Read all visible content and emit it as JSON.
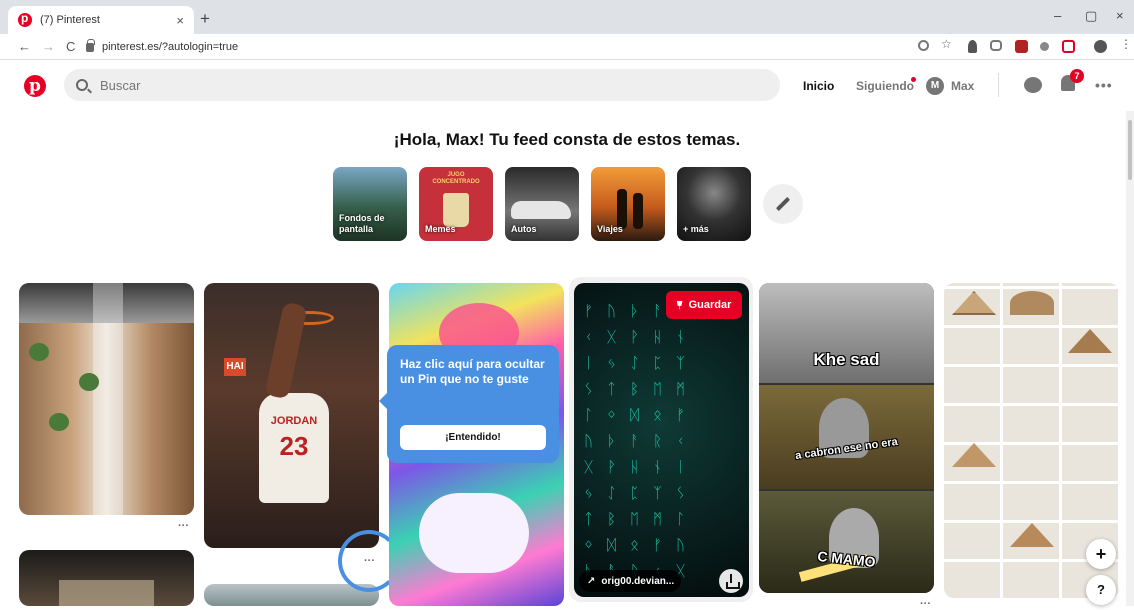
{
  "browser": {
    "tab_title": "(7) Pinterest",
    "tab_close": "×",
    "new_tab": "+",
    "url": "pinterest.es/?autologin=true",
    "back": "←",
    "forward": "→",
    "reload": "C",
    "window_min": "–",
    "window_max": "▢",
    "window_close": "×"
  },
  "header": {
    "logo": "p",
    "search_placeholder": "Buscar",
    "home": "Inicio",
    "following": "Siguiendo",
    "user_initial": "M",
    "user_name": "Max",
    "notifications_count": "7",
    "more": "•••"
  },
  "feed": {
    "greeting": "¡Hola, Max! Tu feed consta de estos temas.",
    "topics": [
      {
        "label": "Fondos de pantalla"
      },
      {
        "label": "Memes"
      },
      {
        "label": "Autos"
      },
      {
        "label": "Viajes"
      },
      {
        "label": "+ más"
      }
    ],
    "meme_sign": "JUGO CONCENTRADO"
  },
  "pins": {
    "more_dots": "···",
    "save_label": "Guardar",
    "link_label": "orig00.devian...",
    "jersey_name": "JORDAN",
    "jersey_number": "23",
    "arena_sign": "HAI",
    "meme_lines": [
      "Khe sad",
      "a cabron ese no era",
      "C MAMO"
    ]
  },
  "tooltip": {
    "text": "Haz clic aquí para ocultar un Pin que no te guste",
    "button": "¡Entendido!"
  },
  "fabs": {
    "add": "+",
    "help": "?"
  }
}
